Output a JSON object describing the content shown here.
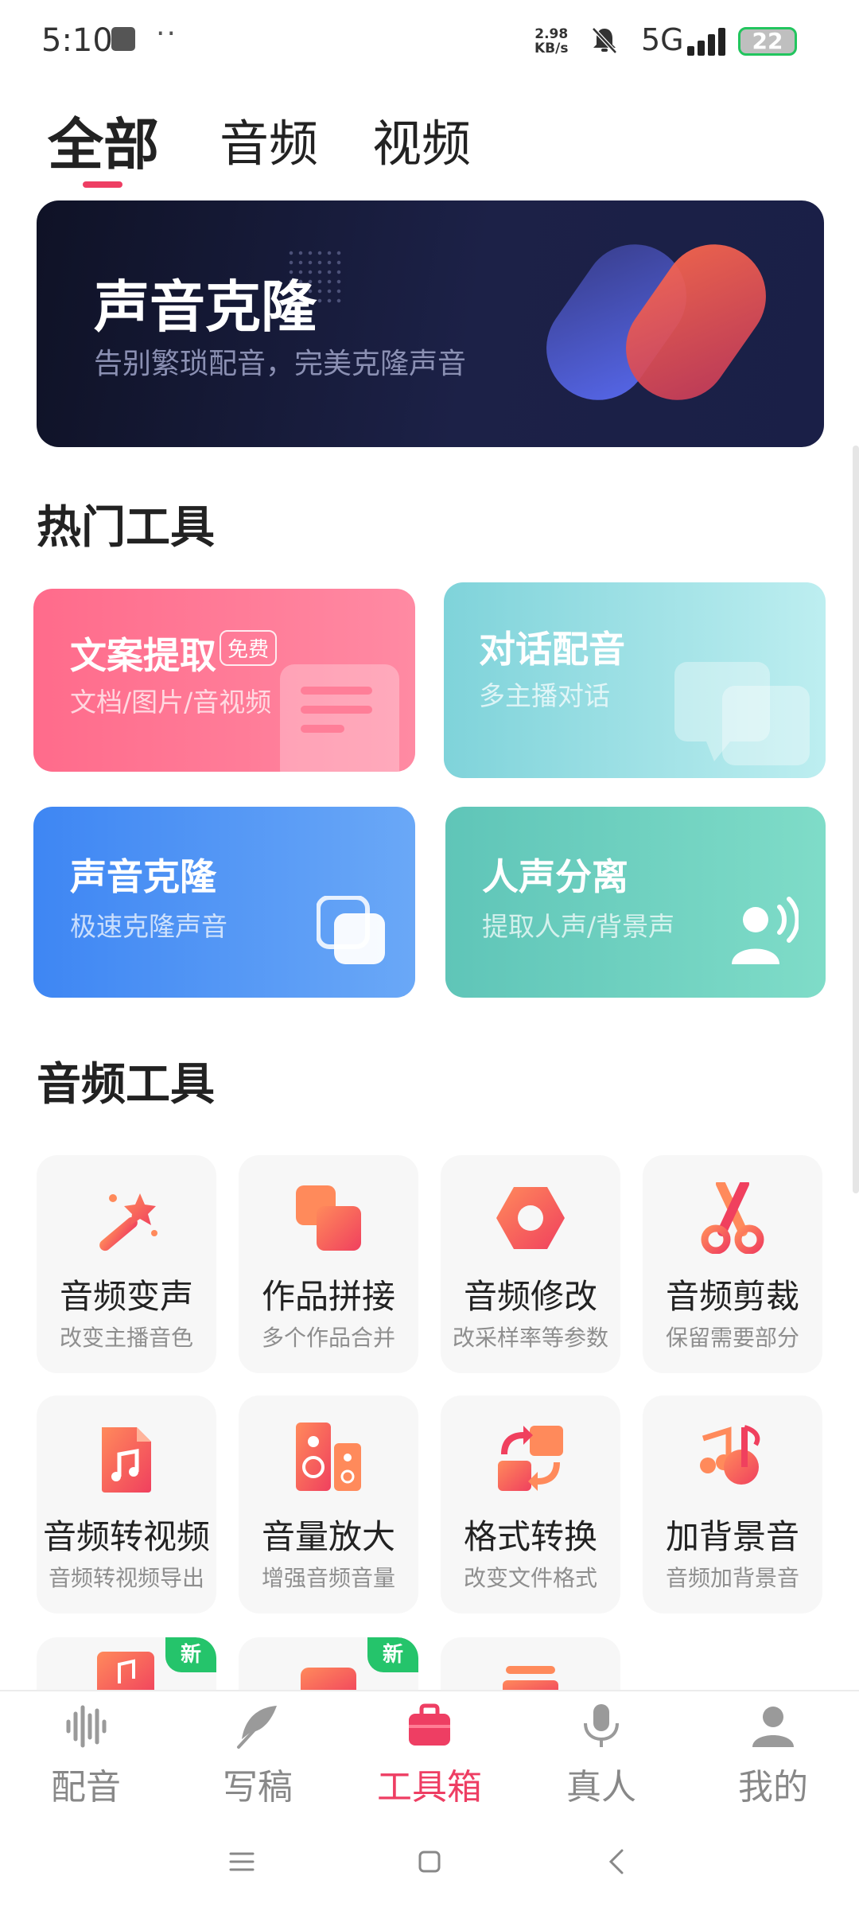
{
  "status_bar": {
    "time": "5:10",
    "dots": "··",
    "net_speed_value": "2.98",
    "net_speed_unit": "KB/s",
    "network": "5G",
    "battery": "22"
  },
  "tabs": [
    {
      "label": "全部",
      "active": true
    },
    {
      "label": "音频",
      "active": false
    },
    {
      "label": "视频",
      "active": false
    }
  ],
  "banner": {
    "title": "声音克隆",
    "subtitle": "告别繁琐配音，完美克隆声音"
  },
  "hot_tools": {
    "title": "热门工具",
    "items": [
      {
        "title": "文案提取",
        "badge": "免费",
        "subtitle": "文档/图片/音视频",
        "icon": "document-icon",
        "color": "#ff6f8c"
      },
      {
        "title": "对话配音",
        "subtitle": "多主播对话",
        "icon": "chat-bubbles-icon",
        "color": "#8fdbe0"
      },
      {
        "title": "声音克隆",
        "subtitle": "极速克隆声音",
        "icon": "copy-icon",
        "color": "#4f95f5"
      },
      {
        "title": "人声分离",
        "subtitle": "提取人声/背景声",
        "icon": "voice-user-icon",
        "color": "#6dd3c1"
      }
    ]
  },
  "audio_tools": {
    "title": "音频工具",
    "items": [
      {
        "name": "音频变声",
        "desc": "改变主播音色",
        "icon": "magic-wand-icon"
      },
      {
        "name": "作品拼接",
        "desc": "多个作品合并",
        "icon": "stacked-squares-icon"
      },
      {
        "name": "音频修改",
        "desc": "改采样率等参数",
        "icon": "hexagon-nut-icon"
      },
      {
        "name": "音频剪裁",
        "desc": "保留需要部分",
        "icon": "scissors-icon"
      },
      {
        "name": "音频转视频",
        "desc": "音频转视频导出",
        "icon": "music-file-icon"
      },
      {
        "name": "音量放大",
        "desc": "增强音频音量",
        "icon": "speaker-icon"
      },
      {
        "name": "格式转换",
        "desc": "改变文件格式",
        "icon": "convert-icon"
      },
      {
        "name": "加背景音",
        "desc": "音频加背景音",
        "icon": "music-note-icon"
      }
    ],
    "partial_badges": [
      "新",
      "新"
    ]
  },
  "bottom_nav": [
    {
      "label": "配音",
      "icon": "waveform-icon",
      "active": false
    },
    {
      "label": "写稿",
      "icon": "feather-icon",
      "active": false
    },
    {
      "label": "工具箱",
      "icon": "toolbox-icon",
      "active": true
    },
    {
      "label": "真人",
      "icon": "microphone-icon",
      "active": false
    },
    {
      "label": "我的",
      "icon": "user-icon",
      "active": false
    }
  ],
  "colors": {
    "accent": "#ee3e63",
    "icon_gradient_start": "#ff8a5b",
    "icon_gradient_end": "#f0405e",
    "new_badge": "#25c46b"
  }
}
